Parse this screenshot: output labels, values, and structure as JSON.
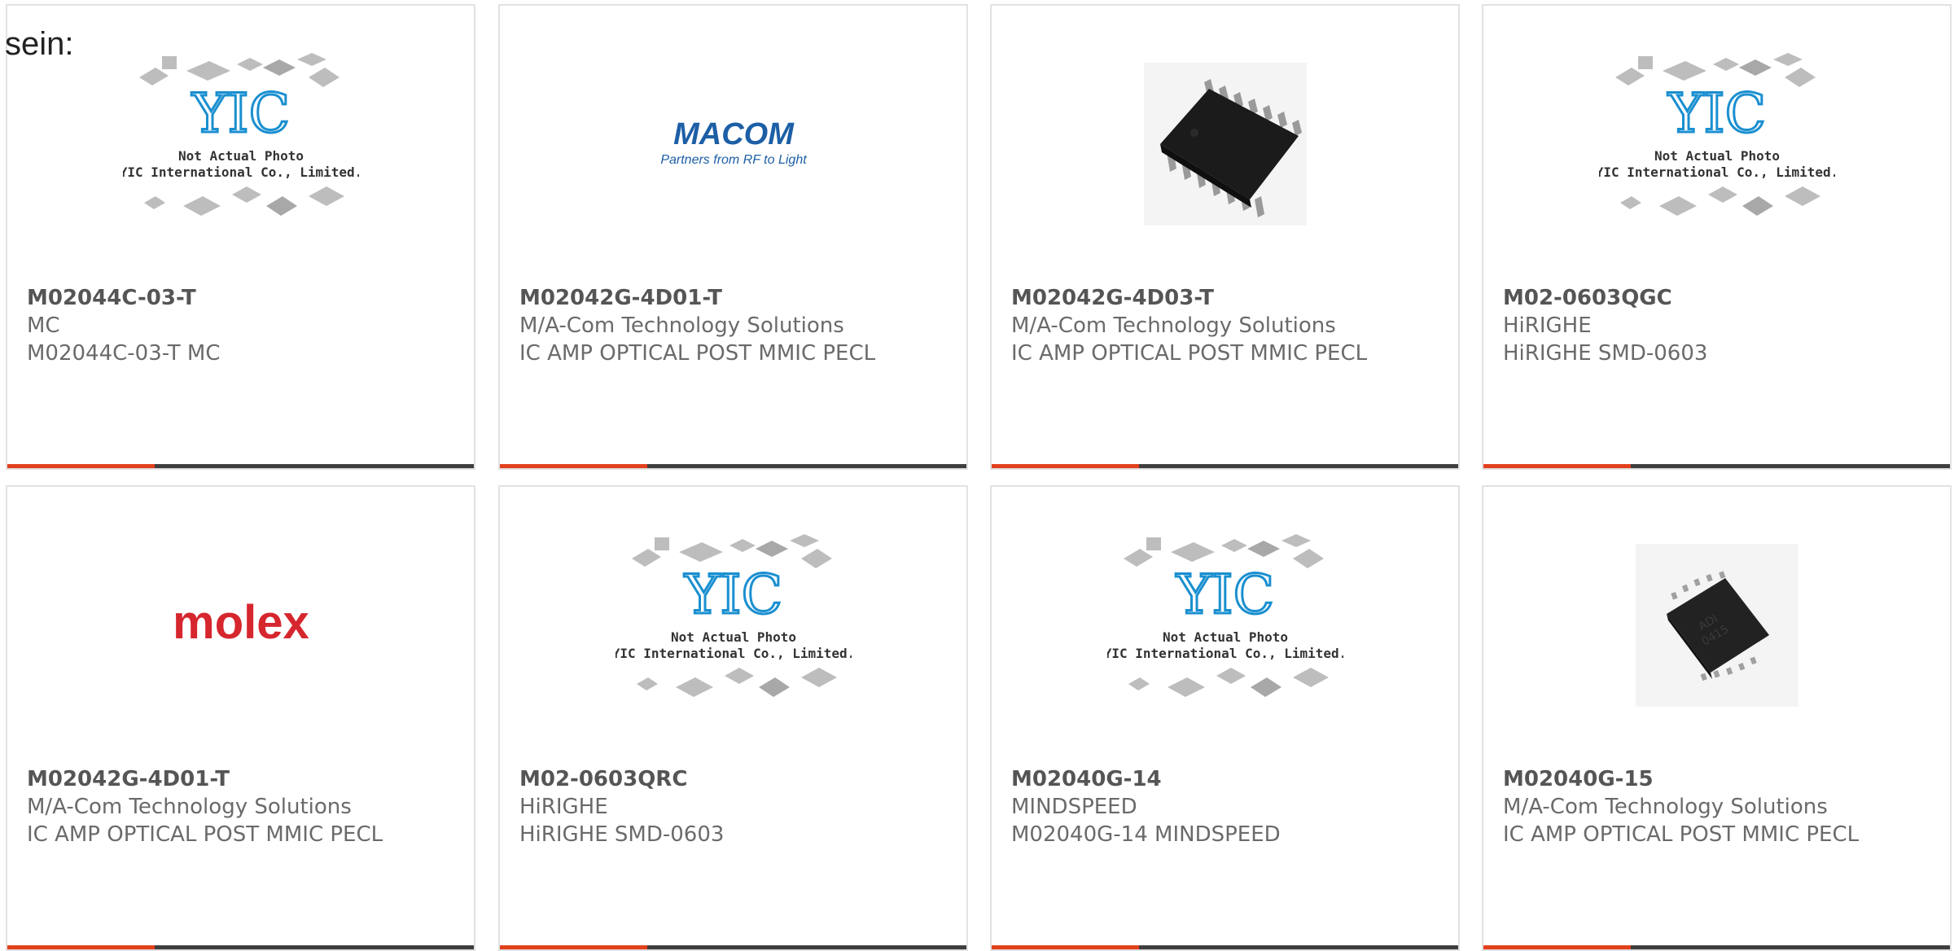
{
  "lead_text": "sein:",
  "placeholder": {
    "logo_text": "YIC",
    "caption_line1": "Not Actual Photo",
    "caption_line2": "YIC International Co., Limited."
  },
  "logos": {
    "macom_name": "MACOM",
    "macom_tagline": "Partners from RF to Light",
    "molex_name": "molex"
  },
  "colors": {
    "accent": "#e2401d",
    "bar": "#3f3f3f",
    "text": "#6a6a6a",
    "border": "#e2e2e2",
    "macom_blue": "#1d5fa6",
    "molex_red": "#d6262e",
    "yic_blue": "#1a8fd0"
  },
  "products": [
    {
      "part": "M02044C-03-T",
      "maker": "MC",
      "desc": "M02044C-03-T MC",
      "image": "placeholder"
    },
    {
      "part": "M02042G-4D01-T",
      "maker": "M/A-Com Technology Solutions",
      "desc": "IC AMP OPTICAL POST MMIC PECL",
      "image": "macom-logo"
    },
    {
      "part": "M02042G-4D03-T",
      "maker": "M/A-Com Technology Solutions",
      "desc": "IC AMP OPTICAL POST MMIC PECL",
      "image": "tssop-chip-photo"
    },
    {
      "part": "M02-0603QGC",
      "maker": "HiRIGHE",
      "desc": "HiRIGHE SMD-0603",
      "image": "placeholder"
    },
    {
      "part": "M02042G-4D01-T",
      "maker": "M/A-Com Technology Solutions",
      "desc": "IC AMP OPTICAL POST MMIC PECL",
      "image": "molex-logo"
    },
    {
      "part": "M02-0603QRC",
      "maker": "HiRIGHE",
      "desc": "HiRIGHE SMD-0603",
      "image": "placeholder"
    },
    {
      "part": "M02040G-14",
      "maker": "MINDSPEED",
      "desc": "M02040G-14 MINDSPEED",
      "image": "placeholder"
    },
    {
      "part": "M02040G-15",
      "maker": "M/A-Com Technology Solutions",
      "desc": "IC AMP OPTICAL POST MMIC PECL",
      "image": "qfn-chip-photo"
    }
  ]
}
